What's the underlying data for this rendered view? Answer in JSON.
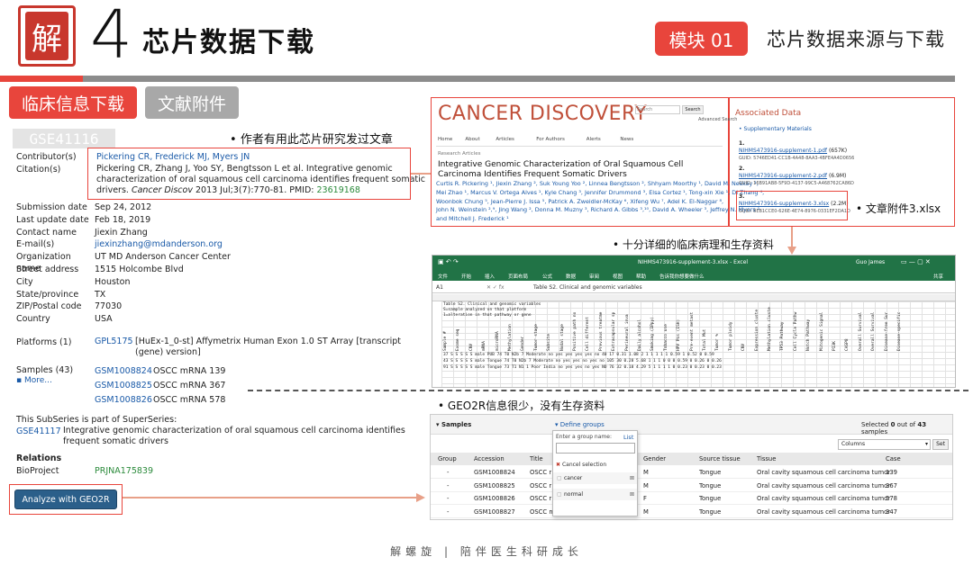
{
  "header": {
    "logo_char": "解",
    "chapter_number": "4",
    "chapter_title": "芯片数据下载",
    "module_badge": "模块 01",
    "module_title": "芯片数据来源与下载"
  },
  "tabs": [
    {
      "label": "临床信息下载"
    },
    {
      "label": "文献附件"
    }
  ],
  "geo": {
    "accession": "GSE41116",
    "note_citation": "作者有用此芯片研究发过文章",
    "contributors_label": "Contributor(s)",
    "contributors": "Pickering CR, Frederick MJ, Myers JN",
    "citation_label": "Citation(s)",
    "citation_line1": "Pickering CR, Zhang J, Yoo SY, Bengtsson L et al. Integrative genomic",
    "citation_line2": "characterization of oral squamous cell carcinoma identifies frequent somatic",
    "citation_line3a": "drivers. ",
    "citation_journal": "Cancer Discov",
    "citation_line3b": " 2013 Jul;3(7):770-81. PMID: ",
    "citation_pmid": "23619168",
    "fields": [
      {
        "k": "Submission date",
        "v": "Sep 24, 2012"
      },
      {
        "k": "Last update date",
        "v": "Feb 18, 2019"
      },
      {
        "k": "Contact name",
        "v": "Jiexin Zhang"
      },
      {
        "k": "E-mail(s)",
        "v": "jiexinzhang@mdanderson.org"
      },
      {
        "k": "Organization name",
        "v": "UT MD Anderson Cancer Center"
      },
      {
        "k": "Street address",
        "v": "1515 Holcombe Blvd"
      },
      {
        "k": "City",
        "v": "Houston"
      },
      {
        "k": "State/province",
        "v": "TX"
      },
      {
        "k": "ZIP/Postal code",
        "v": "77030"
      },
      {
        "k": "Country",
        "v": "USA"
      }
    ],
    "platforms_label": "Platforms (1)",
    "platform_id": "GPL5175",
    "platform_desc1": "[HuEx-1_0-st] Affymetrix Human Exon 1.0 ST Array [transcript",
    "platform_desc2": "(gene) version]",
    "samples_label": "Samples (43)",
    "samples_more": "More...",
    "samples": [
      {
        "id": "GSM1008824",
        "name": "OSCC mRNA 139"
      },
      {
        "id": "GSM1008825",
        "name": "OSCC mRNA 367"
      },
      {
        "id": "GSM1008826",
        "name": "OSCC mRNA 578"
      }
    ],
    "superseries_text": "This SubSeries is part of SuperSeries:",
    "superseries_id": "GSE41117",
    "superseries_desc1": "Integrative genomic characterization of oral squamous cell carcinoma identifies",
    "superseries_desc2": "frequent somatic drivers",
    "relations_label": "Relations",
    "bioproject_label": "BioProject",
    "bioproject_id": "PRJNA175839",
    "geo2r_button": "Analyze with GEO2R"
  },
  "cancer_discovery": {
    "logo": "CANCER DISCOVERY",
    "search_placeholder": "Search",
    "search_button": "Search",
    "advanced_search": "Advanced Search",
    "nav": [
      "Home",
      "About",
      "Articles",
      "For Authors",
      "Alerts",
      "News"
    ],
    "breadcrumb": "Research Articles",
    "article_title": "Integrative Genomic Characterization of Oral Squamous Cell Carcinoma Identifies Frequent Somatic Drivers",
    "authors_line1": "Curtis R. Pickering ¹, Jiexin Zhang ², Suk Young Yoo ², Linnea Bengtsson ², Shhyam Moorthy ¹, David M. Neskey ¹,",
    "authors_line2": "Mei Zhao ¹, Marcus V. Ortega Alves ¹, Kyle Chang ³, Jennifer Drummond ³, Elsa Cortez ¹, Tong-xin Xie ¹, Di Zhang ⁴,",
    "authors_line3": "Woonbok Chung ⁵, Jean-Pierre J. Issa ⁵, Patrick A. Zweidler-McKay ⁶, Xifeng Wu ⁷, Adel K. El-Naggar ⁸,",
    "authors_line4": "John N. Weinstein ²,⁹, Jing Wang ², Donna M. Muzny ³, Richard A. Gibbs ³,¹⁰, David A. Wheeler ³, Jeffrey N. Myers ¹",
    "authors_line5": "and Mitchell J. Frederick ¹",
    "associated_title": "Associated Data",
    "supplementary_label": "Supplementary Materials",
    "supplements": [
      {
        "num": "1.",
        "file": "NIHMS473916-supplement-1.pdf",
        "size": "(657K)",
        "guid": "GUID: 5746ED41-CC1B-4A48-8AA3-4BFE4A4D0656"
      },
      {
        "num": "2.",
        "file": "NIHMS473916-supplement-2.pdf",
        "size": "(6.9M)",
        "guid": "GUID: 16B91AB8-5F9D-4137-99C5-A468762CA86D"
      },
      {
        "num": "3.",
        "file": "NIHMS473916-supplement-3.xlsx",
        "size": "(2.2M)",
        "guid": "GUID: 8EB1CCE0-626E-4E74-8976-0331EF2DA1D"
      }
    ],
    "note_attachment": "文章附件3.xlsx"
  },
  "notes": {
    "clinical": "十分详细的临床病理和生存资料",
    "geo2r": "GEO2R信息很少，没有生存资料"
  },
  "excel": {
    "title": "NIHMS473916-supplement-3.xlsx - Excel",
    "user": "Guo James",
    "ribbon": [
      "文件",
      "开始",
      "插入",
      "页面布局",
      "公式",
      "数据",
      "审阅",
      "视图",
      "帮助",
      "告诉我你想要做什么"
    ],
    "share": "共享",
    "cell_ref": "A1",
    "formula": "Table S2. Clinical and genomic variables",
    "row1": "Table S2. Clinical and genomic variables",
    "row2": "S=sample analyzed on that platform",
    "row3": "1=alteration in that pathway or gene",
    "col_headers": [
      "Sample #",
      "Exome seq",
      "CNV",
      "mRNA",
      "microRNA",
      "Methylation",
      "Gender",
      "Tumor stage",
      "Subsite",
      "Nodal stage",
      "Positive path no",
      "Cell different",
      "Previous treatme",
      "Extracapsular sp",
      "Perineural inva",
      "Daily alcohol",
      "Smoking (1Ppy)",
      "Tobacco use",
      "HPV Pos (ISH)",
      "Pre-event metast",
      "Total Mut",
      "Tumor %",
      "Tumor ploidy",
      "CNV",
      "Expression cluste",
      "Methylation cluste",
      "TP53 Pathway",
      "Cell Cycle Pathw",
      "Notch Pathway",
      "Mitogenic Signal",
      "PI3K",
      "CASP8",
      "Overall Survival",
      "Overall Survival",
      "Disease-free Sur",
      "Disease-specific"
    ],
    "data_rows": [
      "37  S  S  S  S  S  male  PUB  74  T0  N2b  7  Moderate  no  yes  yes  yes  yes  no   40  17  0.31  1.08  2  1  1  1  1  1  0.59  1  0.52  0  0.59",
      "43  S  S  S  S  S  male  Tongue  74  T0  N2b  7  Moderate  no  yes  yes  no   yes  no  105  30  0.28  5.68  1  1  1  0  0  0  0.59  0  0.26  0  0.26",
      "91  S  S  S  S  S  male  Tongue  73  T1  N1  1  Poor  India  no  yes  yes  no  yes  NO  76  32  0.18  4.29  5  1  1  1  1  0  0.23  0  0.23  0  0.23"
    ]
  },
  "geo2r_panel": {
    "samples_label": "Samples",
    "define_groups": "Define groups",
    "selected_prefix": "Selected ",
    "selected_count": "0",
    "selected_suffix": " out of ",
    "total_count": "43",
    "total_suffix": " samples",
    "group_placeholder": "Enter a group name:",
    "list_link": "List",
    "cancel_selection": "Cancel selection",
    "groups": [
      "cancer",
      "normal"
    ],
    "columns_select": "Columns",
    "set_button": "Set",
    "headers": [
      "Group",
      "Accession",
      "Title",
      "Gender",
      "Source tissue",
      "Tissue",
      "Case"
    ],
    "rows": [
      {
        "group": "-",
        "acc": "GSM1008824",
        "title": "OSCC r",
        "gender": "M",
        "source": "Tongue",
        "tissue": "Oral cavity squamous cell carcinoma tumor",
        "case": "139"
      },
      {
        "group": "-",
        "acc": "GSM1008825",
        "title": "OSCC r",
        "gender": "M",
        "source": "Tongue",
        "tissue": "Oral cavity squamous cell carcinoma tumor",
        "case": "367"
      },
      {
        "group": "-",
        "acc": "GSM1008826",
        "title": "OSCC r",
        "gender": "F",
        "source": "Tongue",
        "tissue": "Oral cavity squamous cell carcinoma tumor",
        "case": "578"
      },
      {
        "group": "-",
        "acc": "GSM1008827",
        "title": "OSCC mRNA 347   OSCC",
        "gender": "M",
        "source": "Tongue",
        "tissue": "Oral cavity squamous cell carcinoma tumor",
        "case": "347"
      }
    ]
  },
  "footer": "解螺旋  |  陪伴医生科研成长"
}
